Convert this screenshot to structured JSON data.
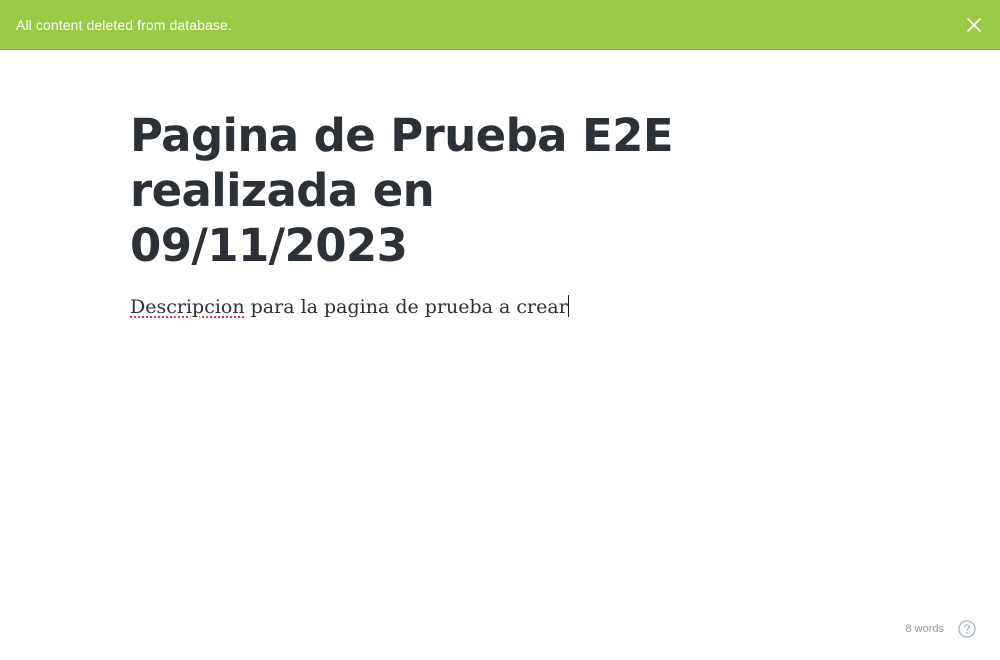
{
  "notification": {
    "message": "All content deleted from database.",
    "close_icon": "close-icon",
    "background_color": "#98cb45"
  },
  "editor": {
    "title_line1": "Pagina de Prueba E2E realizada en",
    "title_line2": "09/11/2023",
    "body_misspelled_word": "Descripcion",
    "body_rest": " para la pagina de prueba a crear"
  },
  "footer": {
    "word_count": "8 words",
    "help_icon": "help-circle-icon"
  }
}
